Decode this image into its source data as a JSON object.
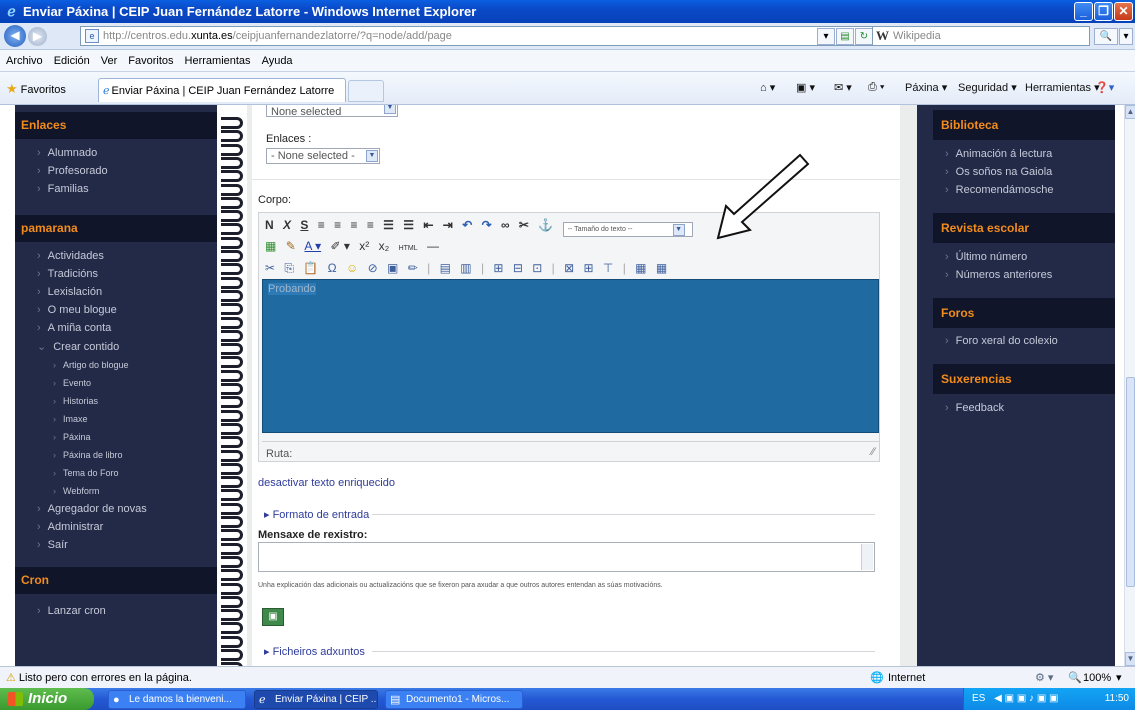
{
  "window": {
    "title": "Enviar Páxina | CEIP Juan Fernández Latorre - Windows Internet Explorer"
  },
  "address": {
    "url_prefix": "http://centros.edu.",
    "url_domain": "xunta.es",
    "url_suffix": "/ceipjuanfernandezlatorre/?q=node/add/page",
    "search_placeholder": "Wikipedia",
    "search_provider_glyph": "W"
  },
  "menu": [
    "Archivo",
    "Edición",
    "Ver",
    "Favoritos",
    "Herramientas",
    "Ayuda"
  ],
  "favorites": {
    "label": "Favoritos",
    "tab_title": "Enviar Páxina | CEIP Juan Fernández Latorre",
    "commands": [
      "Páxina ▾",
      "Seguridad ▾",
      "Herramientas ▾"
    ]
  },
  "left": {
    "sections": [
      {
        "title": "Enlaces",
        "items": [
          "Alumnado",
          "Profesorado",
          "Familias"
        ]
      },
      {
        "title": "pamarana",
        "items": [
          "Actividades",
          "Tradicións",
          "Lexislación",
          "O meu blogue",
          "A miña conta"
        ]
      },
      {
        "title": "Cron",
        "items": [
          "Lanzar cron"
        ]
      }
    ],
    "crear_contido": "Crear contido",
    "crear_sub": [
      "Artigo do blogue",
      "Evento",
      "Historias",
      "Imaxe",
      "Páxina",
      "Páxina de libro",
      "Tema do Foro",
      "Webform"
    ],
    "after_items": [
      "Agregador de novas",
      "Administrar",
      "Saír"
    ]
  },
  "main": {
    "top_select": "None selected",
    "enlaces_label": "Enlaces :",
    "enlaces_select": "- None selected -",
    "corpo_label": "Corpo:",
    "toolbar_row1": [
      "N",
      "X",
      "S",
      "≡",
      "≡",
      "≡",
      "≡",
      "☰",
      "☰",
      "⇤",
      "⇥",
      "↶",
      "↷",
      "∞",
      "✂",
      "⚓"
    ],
    "font_size_select": "-- Tamaño do texto --",
    "toolbar_row2": [
      "▦",
      "✎",
      "A ▾",
      "✐ ▾",
      "x²",
      "x₂",
      "HTML",
      "—"
    ],
    "toolbar_row3": [
      "✂",
      "⎘",
      "📋",
      "Ω",
      "☺",
      "⊘",
      "▣",
      "✏",
      "|",
      "▤",
      "▥",
      "|",
      "⊞",
      "⊟",
      "⊡",
      "|",
      "⊠",
      "⊞",
      "⊤",
      "|",
      "▦",
      "▦"
    ],
    "editor_text": "Probando",
    "ruta_label": "Ruta:",
    "disable_rich": "desactivar texto enriquecido",
    "formato": "▸ Formato de entrada",
    "mensaxe_label": "Mensaxe de rexistro:",
    "mensaxe_help": "Unha explicación das adicionais ou actualizacións que se fixeron para axudar a que outros autores entendan as súas motivacións.",
    "ficheiros": "▸ Ficheiros adxuntos"
  },
  "right": {
    "sections": [
      {
        "title": "Biblioteca",
        "items": [
          "Animación á lectura",
          "Os soños na Gaiola",
          "Recomendámosche"
        ]
      },
      {
        "title": "Revista escolar",
        "items": [
          "Último número",
          "Números anteriores"
        ]
      },
      {
        "title": "Foros",
        "items": [
          "Foro xeral do colexio"
        ]
      },
      {
        "title": "Suxerencias",
        "items": [
          "Feedback"
        ]
      }
    ]
  },
  "status": {
    "text": "Listo pero con errores en la página.",
    "zone": "Internet",
    "zoom": "100%"
  },
  "taskbar": {
    "start": "Inicio",
    "tasks": [
      "Le damos la bienveni...",
      "Enviar Páxina | CEIP ...",
      "Documento1 - Micros..."
    ],
    "lang": "ES",
    "time": "11:50"
  }
}
